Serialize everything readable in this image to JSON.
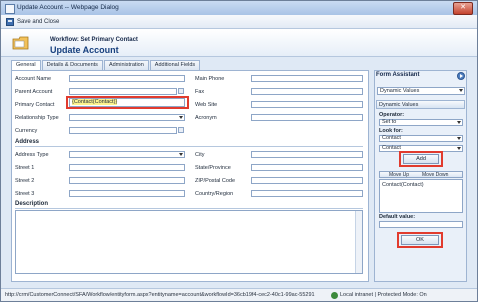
{
  "window": {
    "title": "Update Account -- Webpage Dialog",
    "close_glyph": "✕"
  },
  "toolbar": {
    "save_close_label": "Save and Close"
  },
  "header": {
    "workflow_label": "Workflow: Set Primary Contact",
    "entity_title": "Update Account"
  },
  "tabs": [
    {
      "label": "General",
      "active": true
    },
    {
      "label": "Details & Documents",
      "active": false
    },
    {
      "label": "Administration",
      "active": false
    },
    {
      "label": "Additional Fields",
      "active": false
    }
  ],
  "form": {
    "left_labels": [
      "Account Name",
      "Parent Account",
      "Primary Contact",
      "Relationship Type",
      "Currency"
    ],
    "right_labels": [
      "Main Phone",
      "Fax",
      "Web Site",
      "Acronym"
    ],
    "primary_contact_value": "{Contact(Contact)}",
    "address_section": "Address",
    "address_left_labels": [
      "Address Type",
      "Street 1",
      "Street 2",
      "Street 3"
    ],
    "address_right_labels": [
      "City",
      "State/Province",
      "ZIP/Postal Code",
      "Country/Region"
    ],
    "description_section": "Description"
  },
  "assistant": {
    "title": "Form Assistant",
    "select_top": "Dynamic Values",
    "panel_head": "Dynamic Values",
    "operator_label": "Operator:",
    "operator_value": "Set to",
    "lookfor_label": "Look for:",
    "lookfor_value1": "Contact",
    "lookfor_value2": "Contact",
    "add_label": "Add",
    "move_up": "Move Up",
    "move_down": "Move Down",
    "list_item": "Contact(Contact)",
    "default_label": "Default value:",
    "ok_label": "OK"
  },
  "statusbar": {
    "url": "http://crm/CustomerConnect/SFA/Workflow/entityform.aspx?entityname=account&workflowId=36cb19f4-cec2-40c1-99ac-55291",
    "zone": "Local intranet | Protected Mode: On"
  },
  "colors": {
    "highlight": "#e13b2e",
    "title_blue": "#17407e"
  }
}
